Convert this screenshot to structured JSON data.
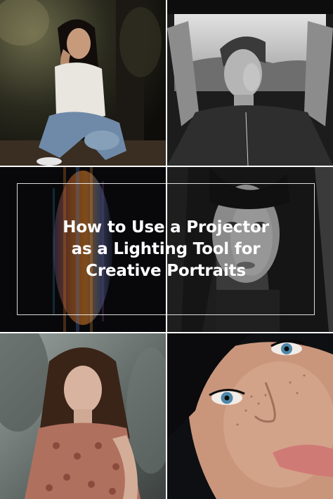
{
  "title_lines": [
    "How to Use a Projector",
    "as a Lighting Tool for",
    "Creative Portraits"
  ],
  "colors": {
    "background": "#ffffff",
    "title_text": "#ffffff",
    "frame_border": "#ffffff"
  },
  "photos": [
    {
      "name": "photo-woman-sitting-forest"
    },
    {
      "name": "photo-man-car-window-bw"
    },
    {
      "name": "photo-projected-light-dark"
    },
    {
      "name": "photo-woman-bangs-bw"
    },
    {
      "name": "photo-woman-floral-dress"
    },
    {
      "name": "photo-freckled-face-closeup"
    }
  ]
}
